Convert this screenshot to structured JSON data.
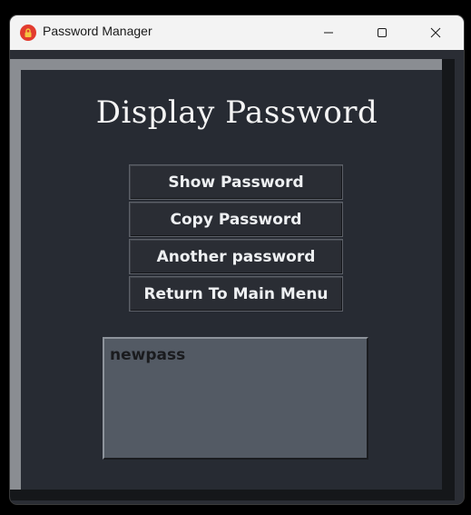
{
  "window": {
    "title": "Password Manager",
    "app_icon": "lock-icon",
    "controls": {
      "minimize_icon": "minimize-icon",
      "maximize_icon": "maximize-icon",
      "close_icon": "close-icon"
    }
  },
  "main": {
    "heading": "Display Password",
    "buttons": [
      {
        "label": "Show Password"
      },
      {
        "label": "Copy Password"
      },
      {
        "label": "Another password"
      },
      {
        "label": "Return To Main Menu"
      }
    ],
    "output": {
      "value": "newpass"
    }
  },
  "colors": {
    "background": "#2a2d34",
    "button_text": "#eef0f2",
    "output_box": "#535a64",
    "title_bar": "#f3f3f3",
    "app_icon": "#e23b2e"
  }
}
